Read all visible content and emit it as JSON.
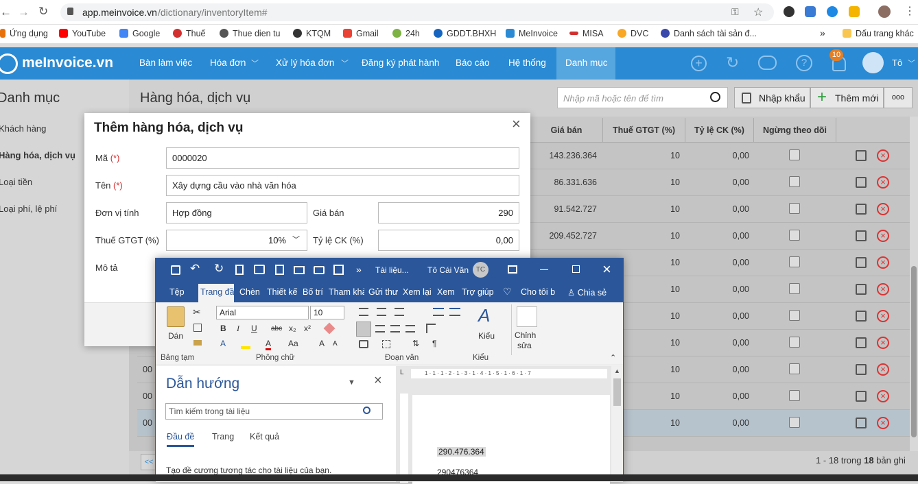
{
  "browser": {
    "url_host": "app.meinvoice.vn",
    "url_path": "/dictionary/inventoryItem#"
  },
  "bookmarks": [
    {
      "label": "Ứng dụng",
      "color": "#e8710a"
    },
    {
      "label": "YouTube",
      "color": "#ff0000"
    },
    {
      "label": "Google",
      "color": "#4285f4"
    },
    {
      "label": "Thuế",
      "color": "#d32f2f"
    },
    {
      "label": "Thue dien tu",
      "color": "#555555"
    },
    {
      "label": "KTQM",
      "color": "#333333"
    },
    {
      "label": "Gmail",
      "color": "#ea4335"
    },
    {
      "label": "24h",
      "color": "#7cb342"
    },
    {
      "label": "GDDT.BHXH",
      "color": "#1565c0"
    },
    {
      "label": "MeInvoice",
      "color": "#2a8ad3"
    },
    {
      "label": "MISA",
      "color": "#d32f2f"
    },
    {
      "label": "DVC",
      "color": "#f9a825"
    },
    {
      "label": "Danh sách tài sản đ...",
      "color": "#3949ab"
    },
    {
      "label": "»",
      "color": ""
    },
    {
      "label": "Dấu trang khác",
      "color": "#f9c74f"
    }
  ],
  "app": {
    "logo": "meInvoice.vn",
    "nav": [
      "Bàn làm việc",
      "Hóa đơn",
      "Xử lý hóa đơn",
      "Đăng ký phát hành",
      "Báo cáo",
      "Hệ thống",
      "Danh mục"
    ],
    "notif_count": "10",
    "user": "Tô",
    "accent": "#2a8ad3"
  },
  "sidebar": {
    "title": "Danh mục",
    "items": [
      "Khách hàng",
      "Hàng hóa, dịch vụ",
      "Loại tiền",
      "Loại phí, lệ phí"
    ]
  },
  "page": {
    "title": "Hàng hóa, dịch vụ",
    "search_placeholder": "Nhập mã hoặc tên để tìm",
    "import_label": "Nhập khẩu",
    "add_label": "Thêm mới",
    "more_label": "ooo"
  },
  "table": {
    "headers": [
      "Giá bán",
      "Thuế GTGT (%)",
      "Tỷ lệ CK (%)",
      "Ngừng theo dõi"
    ],
    "rows": [
      {
        "code": "",
        "price": "143.236.364",
        "vat": "10",
        "ck": "0,00"
      },
      {
        "code": "",
        "price": "86.331.636",
        "vat": "10",
        "ck": "0,00"
      },
      {
        "code": "",
        "price": "91.542.727",
        "vat": "10",
        "ck": "0,00"
      },
      {
        "code": "",
        "price": "209.452.727",
        "vat": "10",
        "ck": "0,00"
      },
      {
        "code": "",
        "price": "",
        "vat": "10",
        "ck": "0,00"
      },
      {
        "code": "",
        "price": "",
        "vat": "10",
        "ck": "0,00"
      },
      {
        "code": "",
        "price": "",
        "vat": "10",
        "ck": "0,00"
      },
      {
        "code": "00",
        "price": "",
        "vat": "10",
        "ck": "0,00"
      },
      {
        "code": "00",
        "price": "",
        "vat": "10",
        "ck": "0,00"
      },
      {
        "code": "00",
        "price": "",
        "vat": "10",
        "ck": "0,00"
      },
      {
        "code": "00",
        "price": "",
        "vat": "10",
        "ck": "0,00"
      }
    ],
    "pager_prev": "<<",
    "footer_pre": "1 - 18 trong ",
    "footer_total": "18",
    "footer_post": " bản ghi"
  },
  "dialog": {
    "title": "Thêm hàng hóa, dịch vụ",
    "ma_label": "Mã",
    "required": "(*)",
    "ma_value": "0000020",
    "ten_label": "Tên",
    "ten_value": "Xây dựng cầu vào nhà văn hóa",
    "dvt_label": "Đơn vị tính",
    "dvt_value": "Hợp đồng",
    "gia_label": "Giá bán",
    "gia_value": "290",
    "thue_label": "Thuế GTGT (%)",
    "thue_value": "10%",
    "ck_label": "Tỷ lệ CK (%)",
    "ck_value": "0,00",
    "mota_label": "Mô tả"
  },
  "word": {
    "doc_name": "Tài liệu...",
    "user": "Tô Cái Văn",
    "initials": "TC",
    "more": "»",
    "tabs": [
      "Tệp",
      "Trang đầu",
      "Chèn",
      "Thiết kế",
      "Bố trí",
      "Tham khả",
      "Gửi thư",
      "Xem lại",
      "Xem",
      "Trợ giúp"
    ],
    "tell": "Cho tôi b",
    "share": "Chia sẻ",
    "font": "Arial",
    "size": "10",
    "groups": [
      "Bảng tạm",
      "Phông chữ",
      "Đoạn văn",
      "Kiểu"
    ],
    "paste": "Dán",
    "styles": "Kiểu",
    "edit1": "Chỉnh",
    "edit2": "sửa",
    "nav_title": "Dẫn hướng",
    "nav_search": "Tìm kiếm trong tài liệu",
    "nav_tabs": [
      "Đầu đề",
      "Trang",
      "Kết quả"
    ],
    "nav_hint": "Tạo đề cương tương tác cho tài liệu của bạn.",
    "ruler": "1 · 1 · 1 · 2 · 1 · 3 · 1 · 4 · 1 · 5 · 1 · 6 · 1 · 7",
    "line1": "290.476.364",
    "line2": "290476364",
    "accent": "#2b579a"
  }
}
